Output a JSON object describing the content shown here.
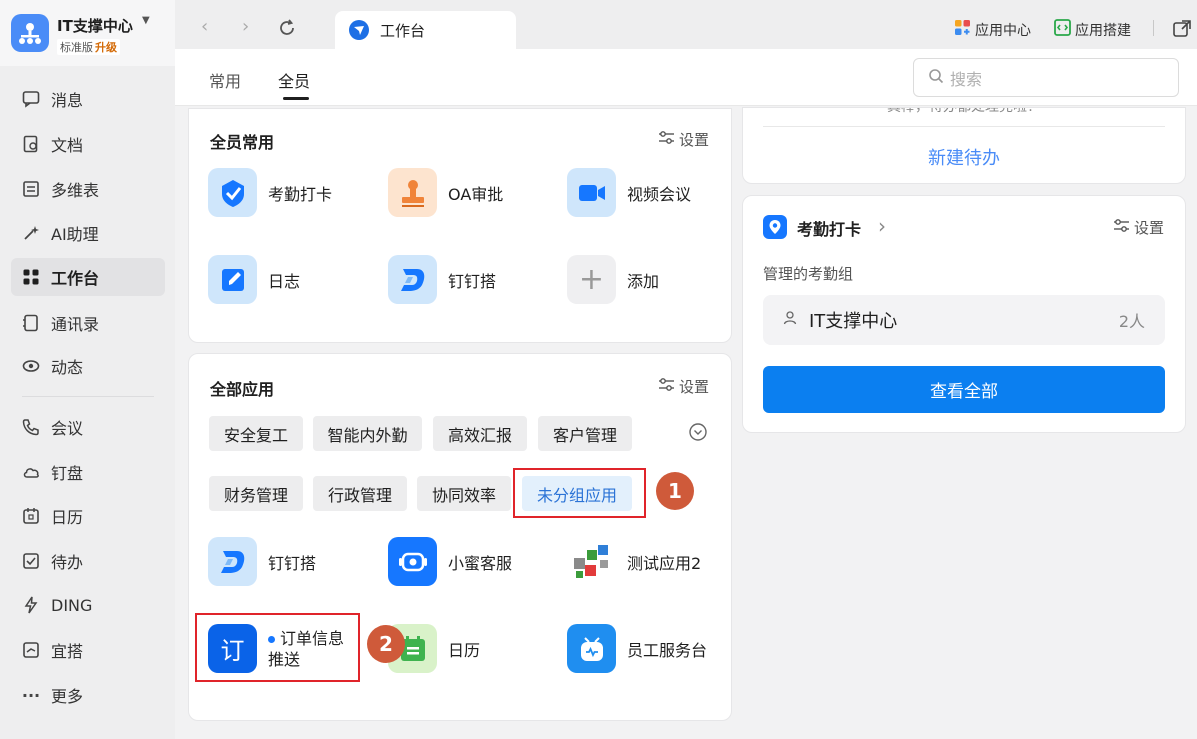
{
  "org": {
    "name": "IT支撑中心",
    "edition": "标准版",
    "upgrade": "升级"
  },
  "sidebar": {
    "items": [
      {
        "label": "消息",
        "icon": "chat-bubble-icon"
      },
      {
        "label": "文档",
        "icon": "document-icon"
      },
      {
        "label": "多维表",
        "icon": "table-icon"
      },
      {
        "label": "AI助理",
        "icon": "ai-wand-icon"
      },
      {
        "label": "工作台",
        "icon": "grid-icon",
        "active": true
      },
      {
        "label": "通讯录",
        "icon": "contacts-icon"
      },
      {
        "label": "动态",
        "icon": "eye-icon"
      },
      {
        "label": "会议",
        "icon": "phone-icon"
      },
      {
        "label": "钉盘",
        "icon": "cloud-icon"
      },
      {
        "label": "日历",
        "icon": "calendar-icon"
      },
      {
        "label": "待办",
        "icon": "checkbox-icon"
      },
      {
        "label": "DING",
        "icon": "lightning-icon"
      },
      {
        "label": "宜搭",
        "icon": "yida-icon"
      },
      {
        "label": "更多",
        "icon": "more-icon"
      }
    ]
  },
  "topbar": {
    "tab_label": "工作台",
    "app_center": "应用中心",
    "app_builder": "应用搭建"
  },
  "header": {
    "tabs": [
      "常用",
      "全员"
    ],
    "active_tab": "全员",
    "search_placeholder": "搜索"
  },
  "common_card": {
    "title": "全员常用",
    "settings": "设置",
    "apps": [
      {
        "label": "考勤打卡",
        "icon": "check-shield-icon"
      },
      {
        "label": "OA审批",
        "icon": "stamp-icon"
      },
      {
        "label": "视频会议",
        "icon": "video-camera-icon"
      },
      {
        "label": "日志",
        "icon": "pencil-note-icon"
      },
      {
        "label": "钉钉搭",
        "icon": "dingda-logo-icon"
      },
      {
        "label": "添加",
        "icon": "plus-icon"
      }
    ]
  },
  "all_apps_card": {
    "title": "全部应用",
    "settings": "设置",
    "chips_row1": [
      "安全复工",
      "智能内外勤",
      "高效汇报",
      "客户管理"
    ],
    "chips_row2": [
      "财务管理",
      "行政管理",
      "协同效率",
      "未分组应用"
    ],
    "selected_chip": "未分组应用",
    "apps": [
      {
        "label": "钉钉搭",
        "icon": "dingda-logo-icon"
      },
      {
        "label": "小蜜客服",
        "icon": "customer-service-icon"
      },
      {
        "label": "测试应用2",
        "icon": "cubes-icon"
      },
      {
        "label": "订单信息推送",
        "icon_text": "订"
      },
      {
        "label": "日历",
        "icon": "calendar-app-icon"
      },
      {
        "label": "员工服务台",
        "icon": "robot-icon"
      }
    ]
  },
  "annotations": {
    "badge1": "1",
    "badge2": "2"
  },
  "todo_card": {
    "cut_text": "真棒，待办都处理完啦！",
    "new_todo": "新建待办"
  },
  "attendance_card": {
    "title": "考勤打卡",
    "settings": "设置",
    "subtitle": "管理的考勤组",
    "group_name": "IT支撑中心",
    "group_count": "2人",
    "view_all": "查看全部"
  },
  "colors": {
    "accent": "#0b7ff0",
    "highlight_red": "#e0242a",
    "badge": "#cf5a3a"
  }
}
